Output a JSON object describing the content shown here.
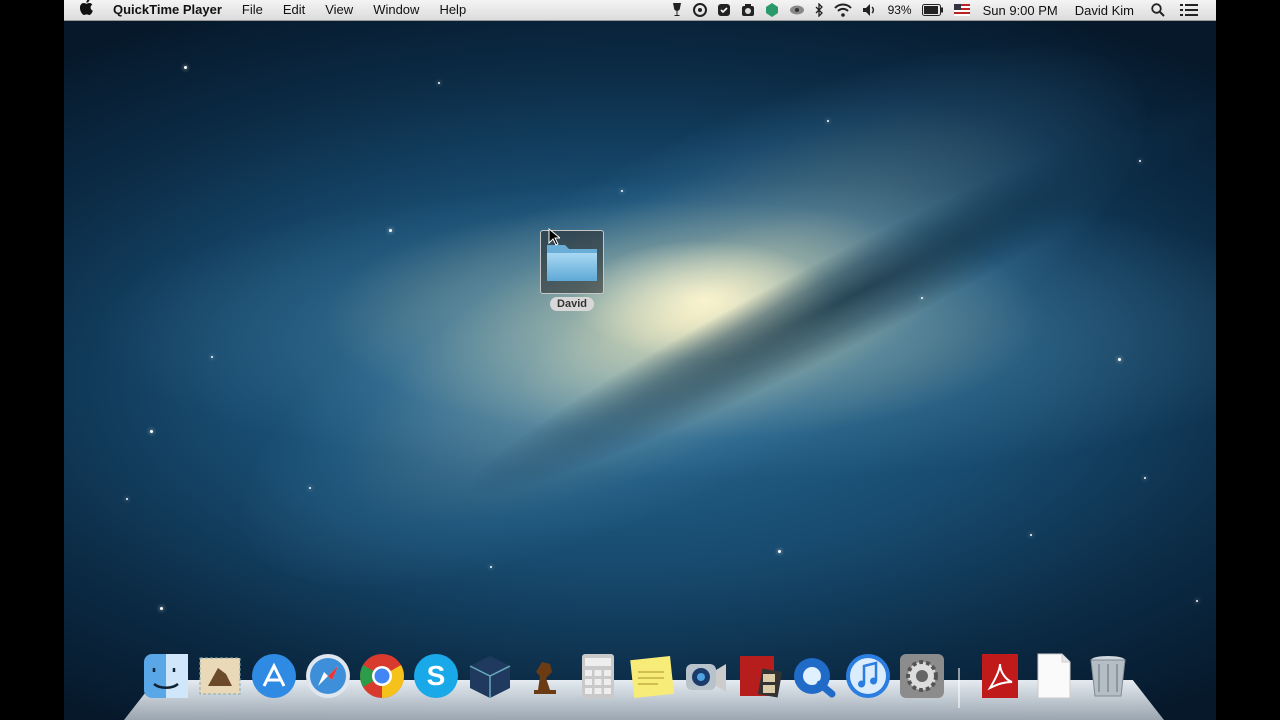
{
  "menubar": {
    "apple_icon": "apple-logo-icon",
    "app_name": "QuickTime Player",
    "menus": [
      "File",
      "Edit",
      "View",
      "Window",
      "Help"
    ],
    "status": {
      "battery_percent": "93%",
      "clock": "Sun 9:00 PM",
      "user": "David Kim"
    }
  },
  "desktop": {
    "folder_label": "David"
  },
  "dock": {
    "apps": [
      "finder-icon",
      "mail-icon",
      "app-store-icon",
      "safari-icon",
      "chrome-icon",
      "skype-icon",
      "cube-app-icon",
      "chess-icon",
      "calculator-icon",
      "stickies-icon",
      "facetime-icon",
      "photo-booth-icon",
      "quicktime-icon",
      "itunes-icon",
      "system-preferences-icon",
      "adobe-reader-icon",
      "document-icon",
      "trash-icon"
    ]
  },
  "colors": {
    "menubar_bg": "#e8e8e8",
    "wallpaper_dark": "#0b2a44",
    "galaxy_core": "#fff6cf"
  }
}
